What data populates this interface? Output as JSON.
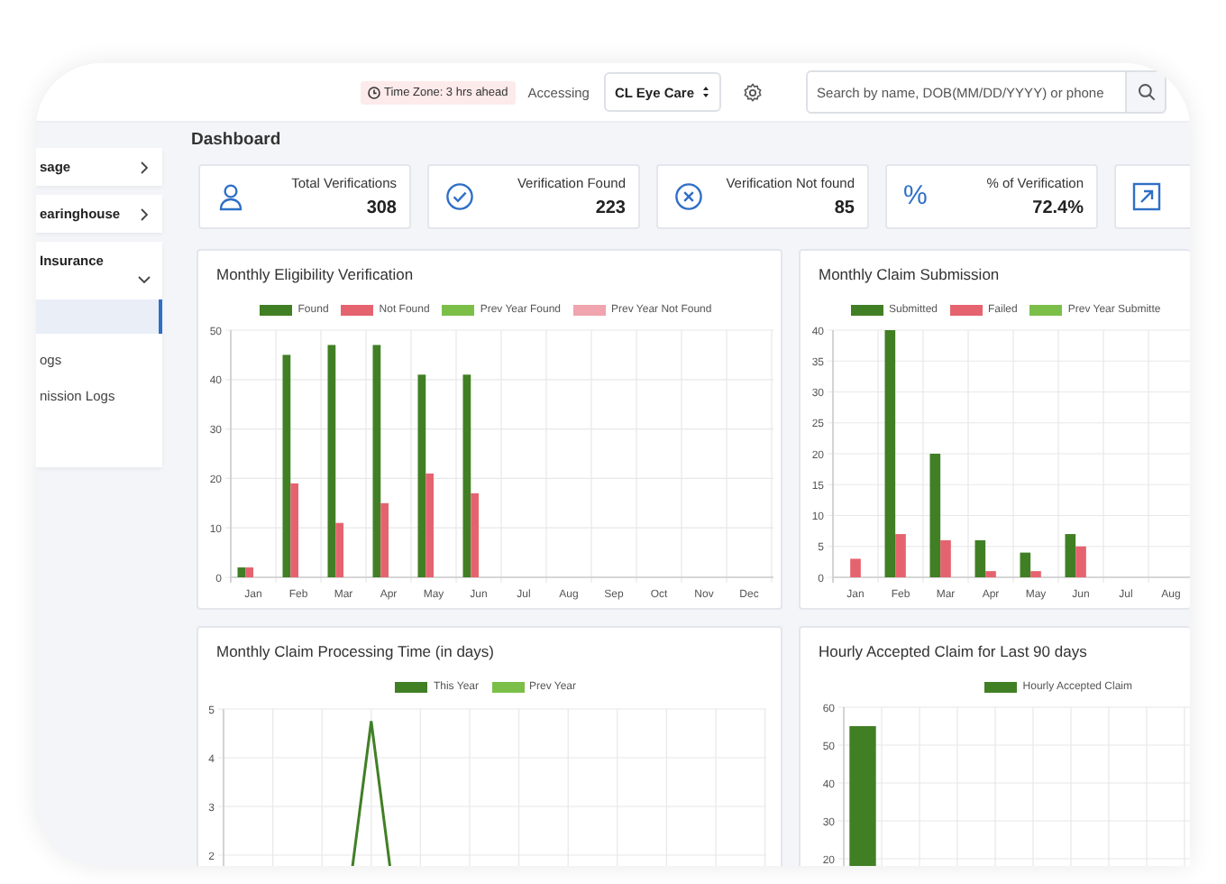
{
  "header": {
    "timezone": "Time Zone: 3 hrs ahead",
    "accessing_label": "Accessing",
    "practice_select": {
      "value": "CL Eye Care"
    },
    "search": {
      "placeholder": "Search by name, DOB(MM/DD/YYYY) or phone"
    }
  },
  "sidebar": {
    "items": [
      {
        "label": "sage",
        "expanded": false
      },
      {
        "label": "earinghouse",
        "expanded": false
      },
      {
        "label": "Insurance",
        "expanded": true,
        "children": [
          {
            "selected": true
          },
          {
            "label": "ogs",
            "selected": false
          },
          {
            "label": "nission Logs",
            "selected": false
          }
        ]
      }
    ]
  },
  "page_title": "Dashboard",
  "stats": [
    {
      "kind": "person",
      "label": "Total Verifications",
      "value": "308"
    },
    {
      "kind": "check",
      "label": "Verification Found",
      "value": "223"
    },
    {
      "kind": "cross",
      "label": "Verification Not found",
      "value": "85"
    },
    {
      "kind": "percent",
      "symbol": "%",
      "label": "% of Verification",
      "value": "72.4%"
    },
    {
      "kind": "external"
    }
  ],
  "charts": [
    {
      "chart_data": {
        "type": "bar",
        "title": "Monthly Eligibility Verification",
        "grid": true,
        "categories": [
          "Jan",
          "Feb",
          "Mar",
          "Apr",
          "May",
          "Jun",
          "Jul",
          "Aug",
          "Sep",
          "Oct",
          "Nov",
          "Dec"
        ],
        "ylim": [
          0,
          50
        ],
        "yticks": [
          0,
          10,
          20,
          30,
          40,
          50
        ],
        "series": [
          {
            "name": "Found",
            "color": "#417f25",
            "values": [
              2,
              45,
              47,
              47,
              41,
              41,
              null,
              null,
              null,
              null,
              null,
              null
            ]
          },
          {
            "name": "Not Found",
            "color": "#e5636f",
            "values": [
              2,
              19,
              11,
              15,
              21,
              17,
              null,
              null,
              null,
              null,
              null,
              null
            ]
          },
          {
            "name": "Prev Year Found",
            "color": "#7bbf49",
            "values": [
              null,
              null,
              null,
              null,
              null,
              null,
              null,
              null,
              null,
              null,
              null,
              null
            ]
          },
          {
            "name": "Prev Year Not Found",
            "color": "#f0a4ae",
            "values": [
              null,
              null,
              null,
              null,
              null,
              null,
              null,
              null,
              null,
              null,
              null,
              null
            ]
          }
        ]
      }
    },
    {
      "chart_data": {
        "type": "bar",
        "title": "Monthly Claim Submission",
        "grid": true,
        "categories": [
          "Jan",
          "Feb",
          "Mar",
          "Apr",
          "May",
          "Jun",
          "Jul",
          "Aug"
        ],
        "ylim": [
          0,
          40
        ],
        "yticks": [
          0,
          5,
          10,
          15,
          20,
          25,
          30,
          35,
          40
        ],
        "series": [
          {
            "name": "Submitted",
            "color": "#417f25",
            "values": [
              0,
              40,
              20,
              6,
              4,
              7,
              null,
              null
            ]
          },
          {
            "name": "Failed",
            "color": "#e5636f",
            "values": [
              3,
              7,
              6,
              1,
              1,
              5,
              null,
              null
            ]
          },
          {
            "name": "Prev Year Submitte",
            "color": "#7bbf49",
            "values": [
              null,
              null,
              null,
              null,
              null,
              null,
              null,
              null
            ]
          }
        ]
      }
    },
    {
      "title": "Monthly Claim Processing Time (in days)",
      "legend": [
        {
          "name": "This Year",
          "color": "#417f25"
        },
        {
          "name": "Prev Year",
          "color": "#7bbf49"
        }
      ],
      "y_labels": [
        "5",
        "4",
        "3",
        "2"
      ]
    },
    {
      "chart_data": {
        "type": "bar",
        "title": "Hourly Accepted Claim for Last 90 days",
        "grid": true,
        "ylim": [
          0,
          60
        ],
        "yticks": [
          20,
          30,
          40,
          50,
          60
        ],
        "series": [
          {
            "name": "Hourly Accepted Claim",
            "color": "#417f25",
            "values": [
              55
            ]
          }
        ]
      }
    }
  ]
}
